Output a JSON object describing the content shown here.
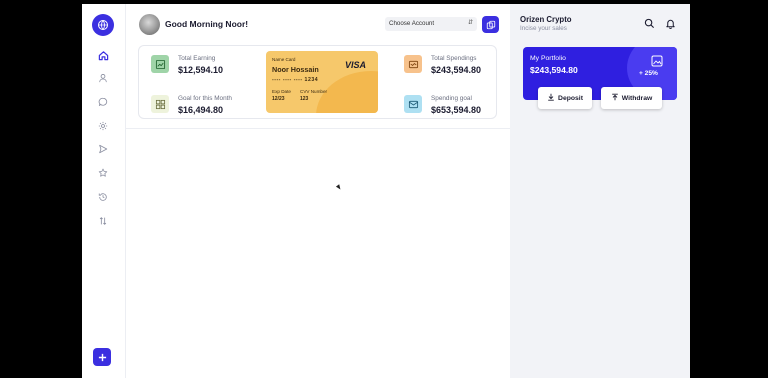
{
  "sidebar": {
    "logo_icon": "globe-icon",
    "items": [
      {
        "icon": "home-icon",
        "active": true
      },
      {
        "icon": "user-icon",
        "active": false
      },
      {
        "icon": "chat-icon",
        "active": false
      },
      {
        "icon": "settings-icon",
        "active": false
      },
      {
        "icon": "send-icon",
        "active": false
      },
      {
        "icon": "star-icon",
        "active": false
      },
      {
        "icon": "history-icon",
        "active": false
      },
      {
        "icon": "sort-icon",
        "active": false
      }
    ],
    "add_icon": "plus-icon"
  },
  "header": {
    "greeting": "Good Morning Noor!",
    "account_select": "Choose Account",
    "copy_icon": "copy-icon"
  },
  "stats": {
    "total_earning": {
      "label": "Total Earning",
      "value": "$12,594.10",
      "icon": "chart-up-icon",
      "color": "#9fd4a8"
    },
    "goal_month": {
      "label": "Goal for this Month",
      "value": "$16,494.80",
      "icon": "grid-icon",
      "color": "#eef3dc"
    },
    "total_spendings": {
      "label": "Total Spendings",
      "value": "$243,594.80",
      "icon": "card-icon",
      "color": "#f7c28c"
    },
    "spending_goal": {
      "label": "Spending goal",
      "value": "$653,594.80",
      "icon": "inbox-icon",
      "color": "#aee0f2"
    }
  },
  "card": {
    "name_label": "Name Card",
    "name": "Noor Hossain",
    "brand": "VISA",
    "number": "---- ---- ---- 1234",
    "exp_label": "Exp Date",
    "exp": "12/23",
    "cvv_label": "CVV Number",
    "cvv": "123"
  },
  "right_panel": {
    "title": "Orizen Crypto",
    "subtitle": "Incise your sales",
    "portfolio_label": "My Portfolio",
    "portfolio_value": "$243,594.80",
    "portfolio_change": "+ 25%",
    "deposit_label": "Deposit",
    "withdraw_label": "Withdraw"
  },
  "colors": {
    "accent": "#3b2fe0",
    "card": "#f6c86b",
    "panel_bg": "#f2f3f7"
  }
}
